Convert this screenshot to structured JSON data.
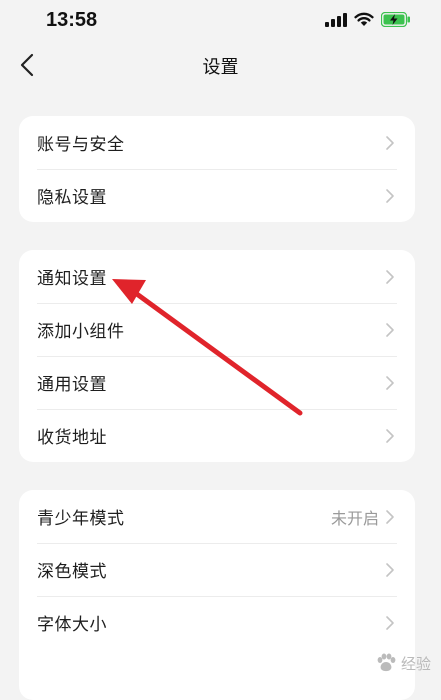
{
  "status_bar": {
    "time": "13:58",
    "icons": [
      "signal-icon",
      "wifi-icon",
      "battery-charging-icon"
    ],
    "battery_color": "#3cc24f"
  },
  "nav": {
    "back_icon": "chevron-left-icon",
    "title": "设置"
  },
  "groups": [
    {
      "items": [
        {
          "label": "账号与安全",
          "value": ""
        },
        {
          "label": "隐私设置",
          "value": ""
        }
      ]
    },
    {
      "items": [
        {
          "label": "通知设置",
          "value": ""
        },
        {
          "label": "添加小组件",
          "value": ""
        },
        {
          "label": "通用设置",
          "value": ""
        },
        {
          "label": "收货地址",
          "value": ""
        }
      ]
    },
    {
      "items": [
        {
          "label": "青少年模式",
          "value": "未开启"
        },
        {
          "label": "深色模式",
          "value": ""
        },
        {
          "label": "字体大小",
          "value": ""
        }
      ]
    }
  ],
  "annotation": {
    "color": "#e0242b",
    "points_to": "通知设置"
  },
  "watermark": {
    "text": "经验",
    "icon": "paw-logo-icon"
  }
}
